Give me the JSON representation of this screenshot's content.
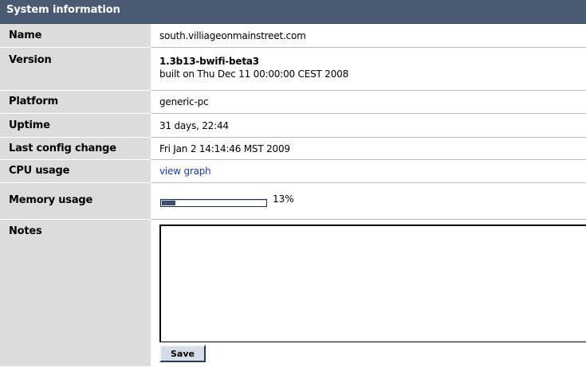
{
  "panel": {
    "title": "System information"
  },
  "rows": {
    "name": {
      "label": "Name",
      "value": "south.villiageonmainstreet.com"
    },
    "version": {
      "label": "Version",
      "value": "1.3b13-bwifi-beta3",
      "built": "built on Thu Dec 11 00:00:00 CEST 2008"
    },
    "platform": {
      "label": "Platform",
      "value": "generic-pc"
    },
    "uptime": {
      "label": "Uptime",
      "value": "31 days, 22:44"
    },
    "last_config_change": {
      "label": "Last config change",
      "value": "Fri Jan 2 14:14:46 MST 2009"
    },
    "cpu_usage": {
      "label": "CPU usage",
      "link_text": "view graph"
    },
    "memory_usage": {
      "label": "Memory usage",
      "percent": 13,
      "percent_text": "13%"
    },
    "notes": {
      "label": "Notes",
      "value": "",
      "save_label": "Save"
    }
  },
  "colors": {
    "title_bg": "#4a5a73",
    "label_bg": "#dcdcdc",
    "link": "#1a3fa8",
    "progress_fill": "#3c4f6d"
  }
}
